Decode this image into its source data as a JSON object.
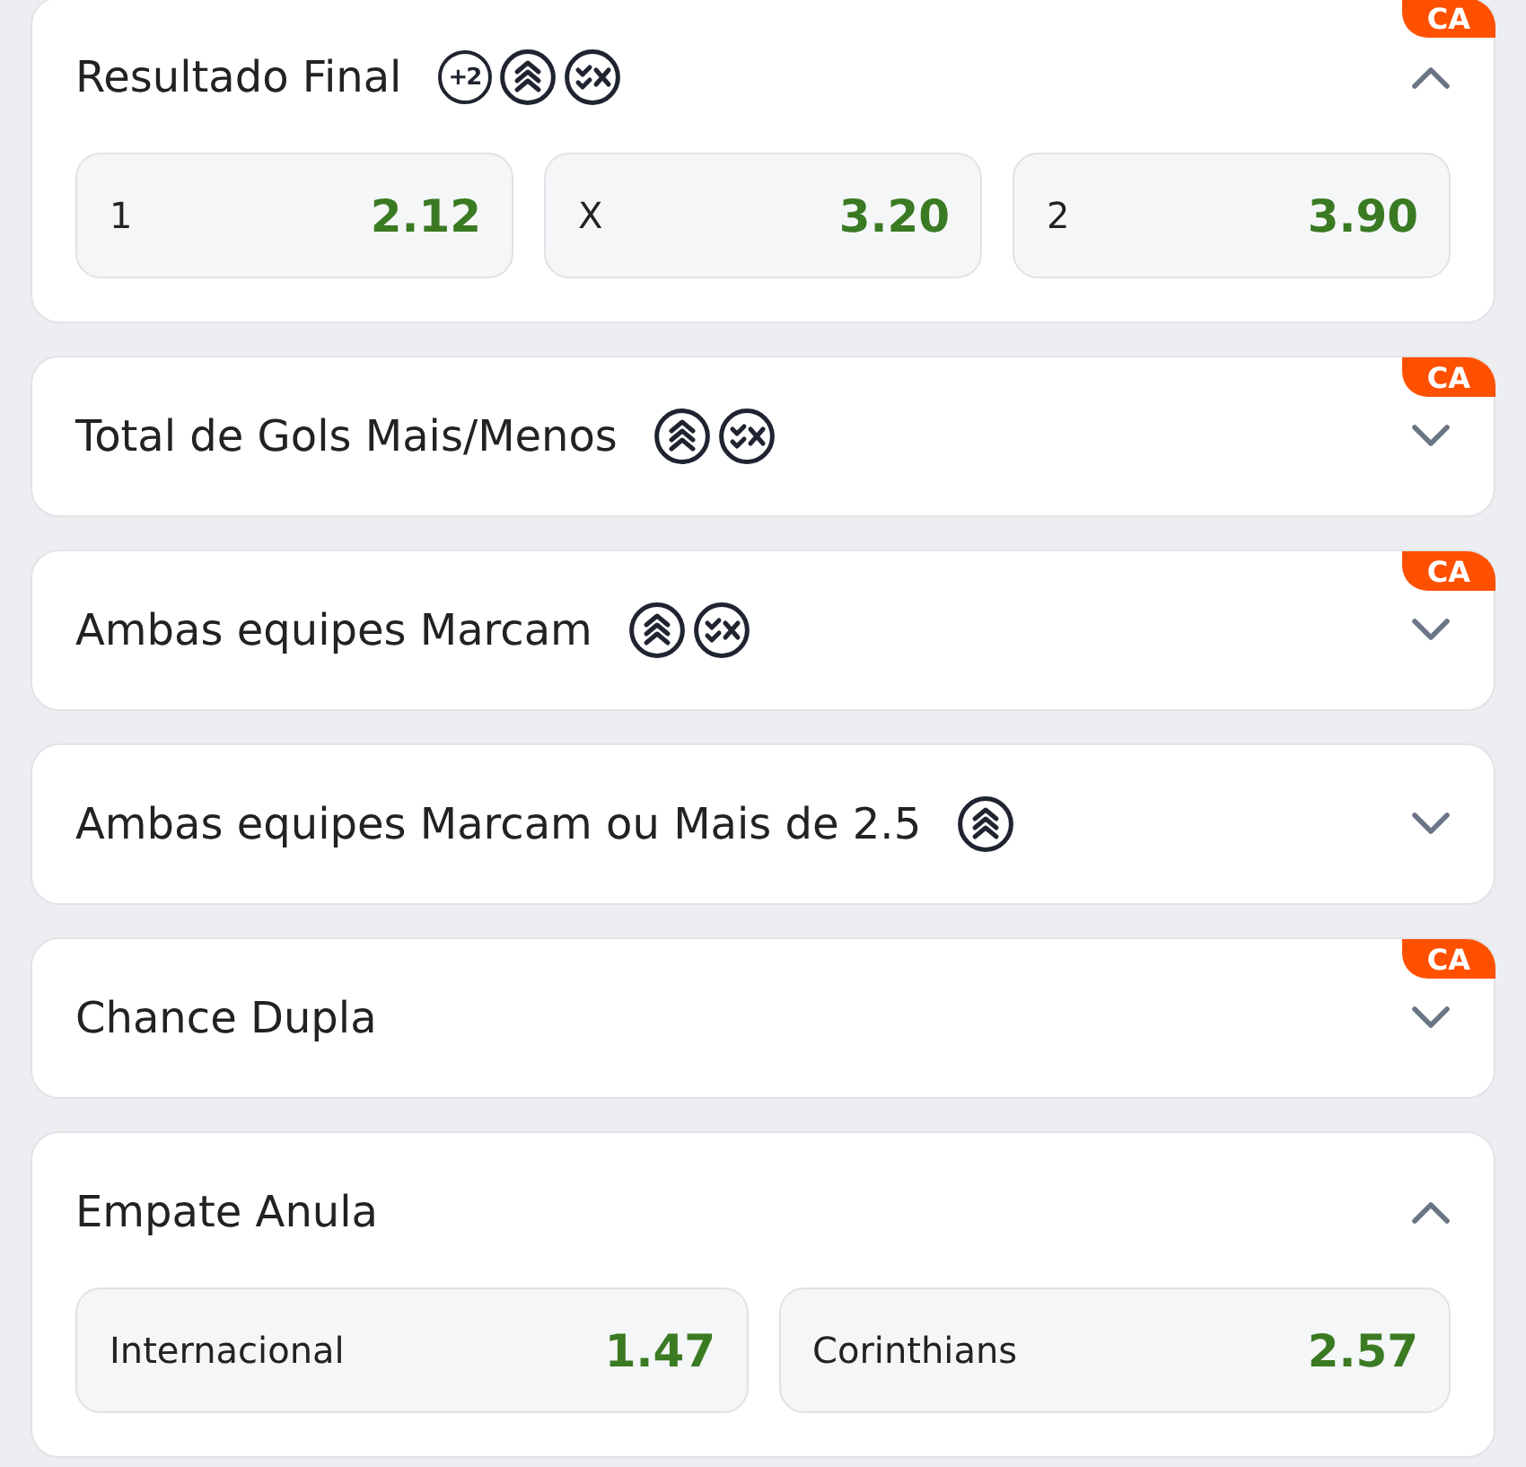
{
  "markets": [
    {
      "title": "Resultado Final",
      "badge": "CA",
      "expanded": true,
      "icons": [
        {
          "kind": "plus",
          "text": "+2"
        },
        {
          "kind": "boost"
        },
        {
          "kind": "cashout"
        }
      ],
      "odds": [
        {
          "label": "1",
          "price": "2.12"
        },
        {
          "label": "X",
          "price": "3.20"
        },
        {
          "label": "2",
          "price": "3.90"
        }
      ]
    },
    {
      "title": "Total de Gols Mais/Menos",
      "badge": "CA",
      "expanded": false,
      "icons": [
        {
          "kind": "boost"
        },
        {
          "kind": "cashout"
        }
      ]
    },
    {
      "title": "Ambas equipes Marcam",
      "badge": "CA",
      "expanded": false,
      "icons": [
        {
          "kind": "boost"
        },
        {
          "kind": "cashout"
        }
      ]
    },
    {
      "title": "Ambas equipes Marcam ou Mais de 2.5",
      "expanded": false,
      "icons": [
        {
          "kind": "boost"
        }
      ]
    },
    {
      "title": "Chance Dupla",
      "badge": "CA",
      "expanded": false
    },
    {
      "title": "Empate Anula",
      "expanded": true,
      "odds": [
        {
          "label": "Internacional",
          "price": "1.47"
        },
        {
          "label": "Corinthians",
          "price": "2.57"
        }
      ]
    }
  ]
}
